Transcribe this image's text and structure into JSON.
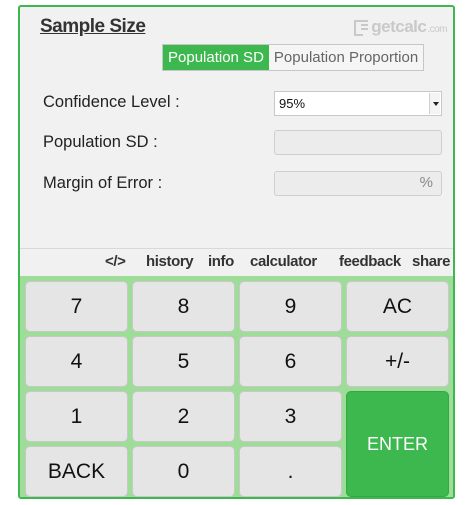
{
  "app": {
    "title": "Sample Size",
    "logo_text": "getcalc",
    "logo_domain": ".com"
  },
  "mode_tabs": [
    {
      "label": "Population SD",
      "active": true
    },
    {
      "label": "Population Proportion",
      "active": false
    }
  ],
  "form": {
    "confidence_label": "Confidence Level :",
    "confidence_value": "95%",
    "population_sd_label": "Population SD :",
    "population_sd_value": "",
    "margin_label": "Margin of Error :",
    "margin_value": "",
    "margin_unit": "%"
  },
  "footer_links": [
    "</>",
    "history",
    "info",
    "calculator",
    "feedback",
    "share"
  ],
  "keys": {
    "k7": "7",
    "k8": "8",
    "k9": "9",
    "ac": "AC",
    "k4": "4",
    "k5": "5",
    "k6": "6",
    "sign": "+/-",
    "k1": "1",
    "k2": "2",
    "k3": "3",
    "enter": "ENTER",
    "back": "BACK",
    "k0": "0",
    "dot": "."
  },
  "colors": {
    "accent": "#3cb84f",
    "keypad_bg": "#9ddd98",
    "key_bg": "#e5e5e5"
  }
}
